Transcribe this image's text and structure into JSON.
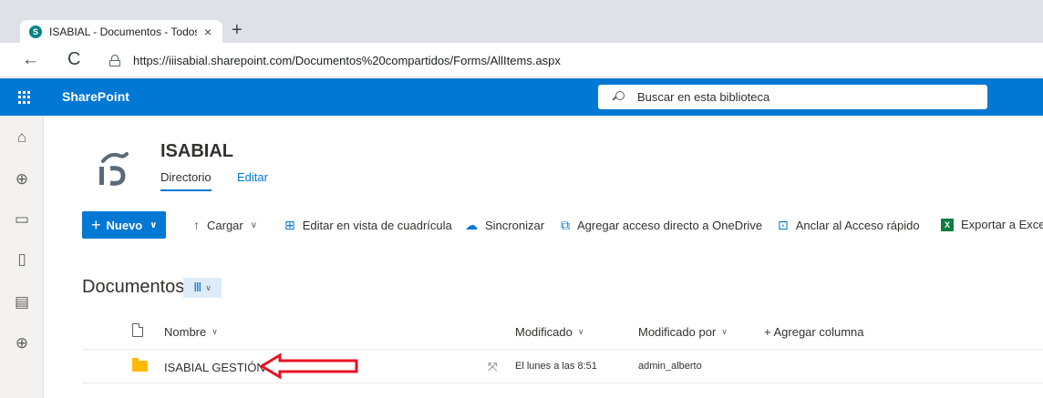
{
  "browser": {
    "tab_title": "ISABIAL - Documentos - Todos lo",
    "tab_close": "×",
    "new_tab": "+",
    "back": "←",
    "reload": "C",
    "url": "https://iiisabial.sharepoint.com/Documentos%20compartidos/Forms/AllItems.aspx"
  },
  "suitebar": {
    "brand": "SharePoint",
    "search_placeholder": "Buscar en esta biblioteca",
    "color": "#0078d4"
  },
  "site": {
    "title": "ISABIAL",
    "nav": [
      "Directorio",
      "Editar"
    ]
  },
  "commandbar": {
    "new_label": "Nuevo",
    "upload": "Cargar",
    "grid_edit": "Editar en vista de cuadrícula",
    "sync": "Sincronizar",
    "shortcut": "Agregar acceso directo a OneDrive",
    "pin": "Anclar al Acceso rápido",
    "export": "Exportar a Excel"
  },
  "library": {
    "title": "Documentos",
    "columns": {
      "name": "Nombre",
      "modified": "Modificado",
      "modified_by": "Modificado por",
      "add_column": "+ Agregar columna"
    },
    "rows": [
      {
        "name": "ISABIAL GESTIÓN",
        "modified": "El lunes a las 8:51",
        "modified_by": "admin_alberto"
      }
    ]
  },
  "annotation_color": "#e81123"
}
